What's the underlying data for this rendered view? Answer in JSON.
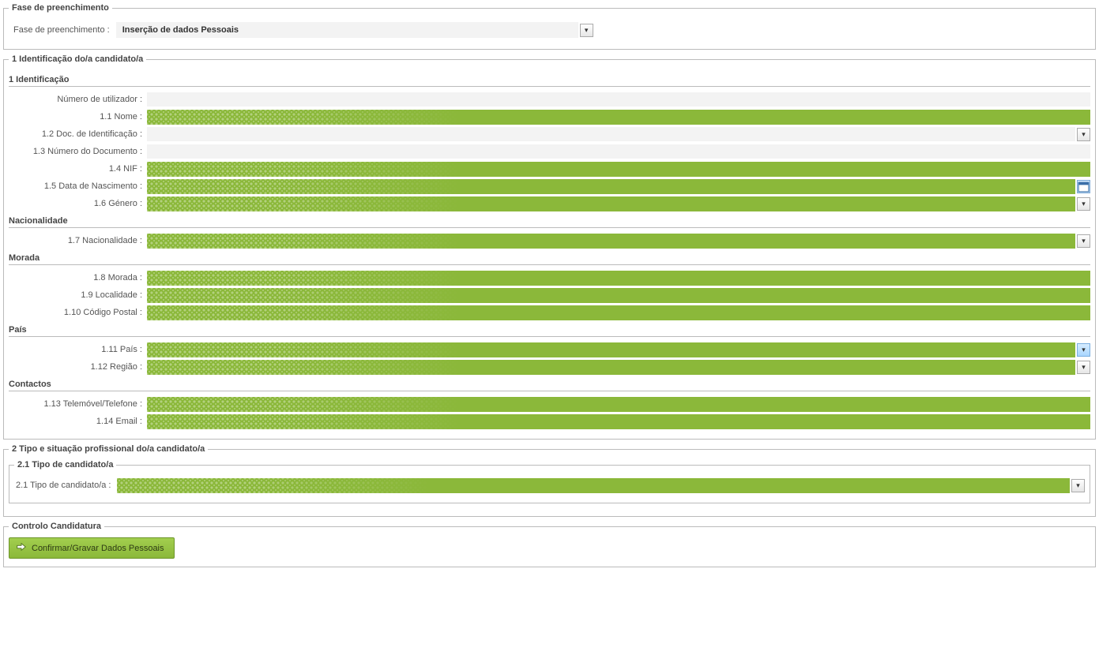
{
  "phase": {
    "legend": "Fase de preenchimento",
    "label": "Fase de preenchimento :",
    "value": "Inserção de dados Pessoais"
  },
  "section1": {
    "legend": "1 Identificação do/a candidato/a",
    "ident": {
      "legend": "1 Identificação",
      "user_number_label": "Número de utilizador :",
      "name_label": "1.1 Nome :",
      "doc_id_label": "1.2 Doc. de Identificação :",
      "doc_num_label": "1.3 Número do Documento :",
      "nif_label": "1.4 NIF :",
      "dob_label": "1.5 Data de Nascimento :",
      "gender_label": "1.6 Género :"
    },
    "nat": {
      "legend": "Nacionalidade",
      "label": "1.7 Nacionalidade :"
    },
    "addr": {
      "legend": "Morada",
      "street_label": "1.8 Morada :",
      "locality_label": "1.9 Localidade :",
      "postal_label": "1.10 Código Postal :"
    },
    "country": {
      "legend": "País",
      "country_label": "1.11 País :",
      "region_label": "1.12 Região :"
    },
    "contacts": {
      "legend": "Contactos",
      "phone_label": "1.13 Telemóvel/Telefone :",
      "email_label": "1.14 Email :"
    }
  },
  "section2": {
    "legend": "2 Tipo e situação profissional do/a candidato/a",
    "type": {
      "legend": "2.1 Tipo de candidato/a",
      "label": "2.1 Tipo de candidato/a :"
    }
  },
  "control": {
    "legend": "Controlo Candidatura",
    "confirm_label": "Confirmar/Gravar Dados Pessoais"
  }
}
